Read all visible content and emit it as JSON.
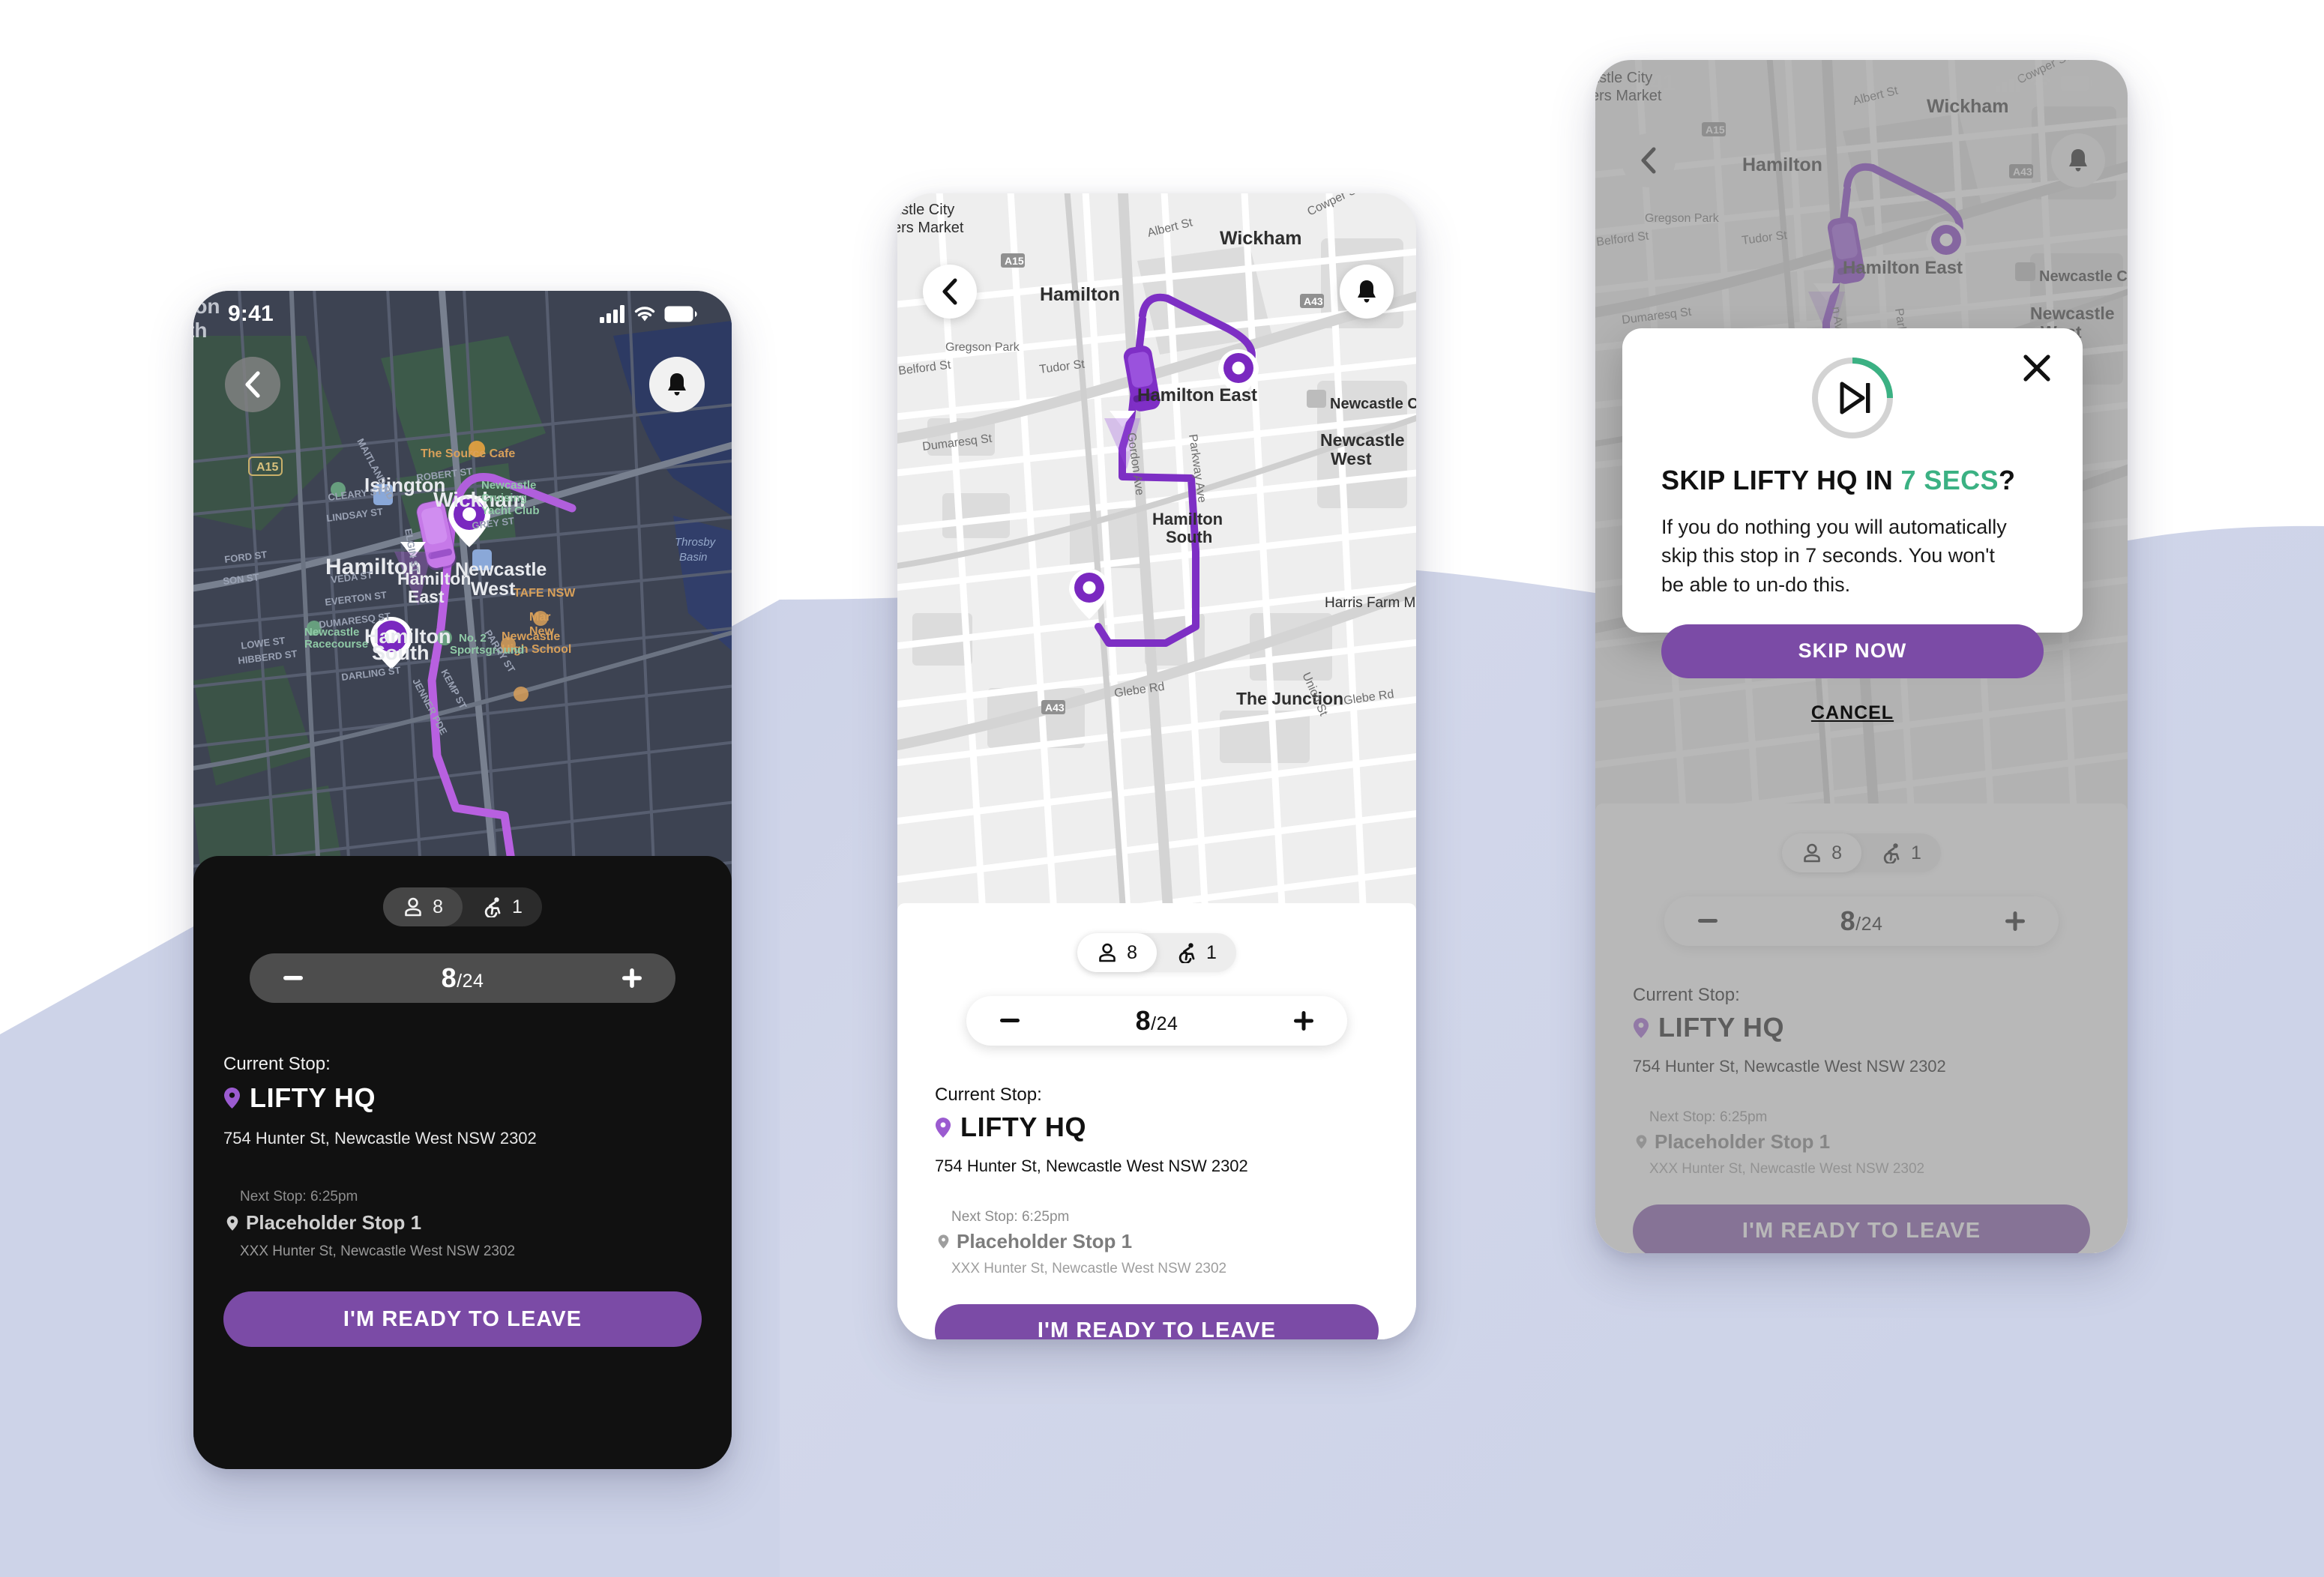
{
  "theme": {
    "brand_purple": "#7b4ba6",
    "accent_green": "#3bb183",
    "dark_sheet": "#111111",
    "background_lavender": "#ccd2e6"
  },
  "status_bar": {
    "time": "9:41",
    "icons": [
      "cellular-signal-icon",
      "wifi-icon",
      "battery-icon"
    ]
  },
  "map": {
    "dark_labels": [
      "Islington",
      "Wickham",
      "Hamilton",
      "Hamilton East",
      "Newcastle West",
      "Hamilton South",
      "The Source Cafe",
      "Newcastle Cruising Yacht Club",
      "Newcastle Racecourse",
      "No. 2 Sportsground",
      "Newcastle High School",
      "TAFE NSW",
      "Throsby Basin",
      "A15",
      "ROBERT ST",
      "CLEARY ST",
      "LINDSAY ST",
      "VEDA ST",
      "EVERTON ST",
      "DUMARESQ ST",
      "GREY ST",
      "PARRY ST",
      "LOWE ST",
      "HIBBERD ST",
      "DARLING ST",
      "KEMP ST",
      "JENNER PDE",
      "ELGIN ST",
      "MAITLAND RD"
    ],
    "light_labels": [
      "astle City",
      "ers Market",
      "Wickham",
      "Hamilton",
      "Hamilton East",
      "Gregson Park",
      "Tudor St",
      "Belford St",
      "Dumaresq St",
      "Newcastle West",
      "Hamilton South",
      "The Junction",
      "Harris Farm M",
      "Newcastle C",
      "Albert St",
      "Glebe Rd",
      "Union St",
      "Gordon Ave",
      "Parkway Ave",
      "Cowper St N",
      "A15",
      "A43"
    ]
  },
  "header": {
    "back_icon": "chevron-left-icon",
    "notification_icon": "bell-icon"
  },
  "occupancy": {
    "passenger_icon": "person-icon",
    "passenger_count": "8",
    "wheelchair_icon": "wheelchair-icon",
    "wheelchair_count": "1"
  },
  "stepper": {
    "minus_icon": "minus-icon",
    "plus_icon": "plus-icon",
    "value": "8",
    "separator": "/",
    "capacity": "24"
  },
  "current_stop": {
    "label": "Current Stop:",
    "pin_icon": "map-pin-icon",
    "name": "LIFTY HQ",
    "address": "754 Hunter St, Newcastle West NSW 2302"
  },
  "next_stop": {
    "label": "Next Stop: 6:25pm",
    "pin_icon": "map-pin-icon",
    "name": "Placeholder Stop 1",
    "address": "XXX Hunter St, Newcastle West NSW 2302"
  },
  "cta": {
    "label": "I'M READY TO LEAVE"
  },
  "modal": {
    "close_icon": "close-icon",
    "ring_icon": "skip-forward-icon",
    "ring_progress_percent": 25,
    "title_pre": "SKIP LIFTY HQ IN ",
    "title_accent": "7 SECS",
    "title_post": "?",
    "body": "If you do nothing you will automatically skip this stop in 7 seconds. You won't be able to un-do this.",
    "primary_label": "SKIP NOW",
    "cancel_label": "CANCEL"
  }
}
